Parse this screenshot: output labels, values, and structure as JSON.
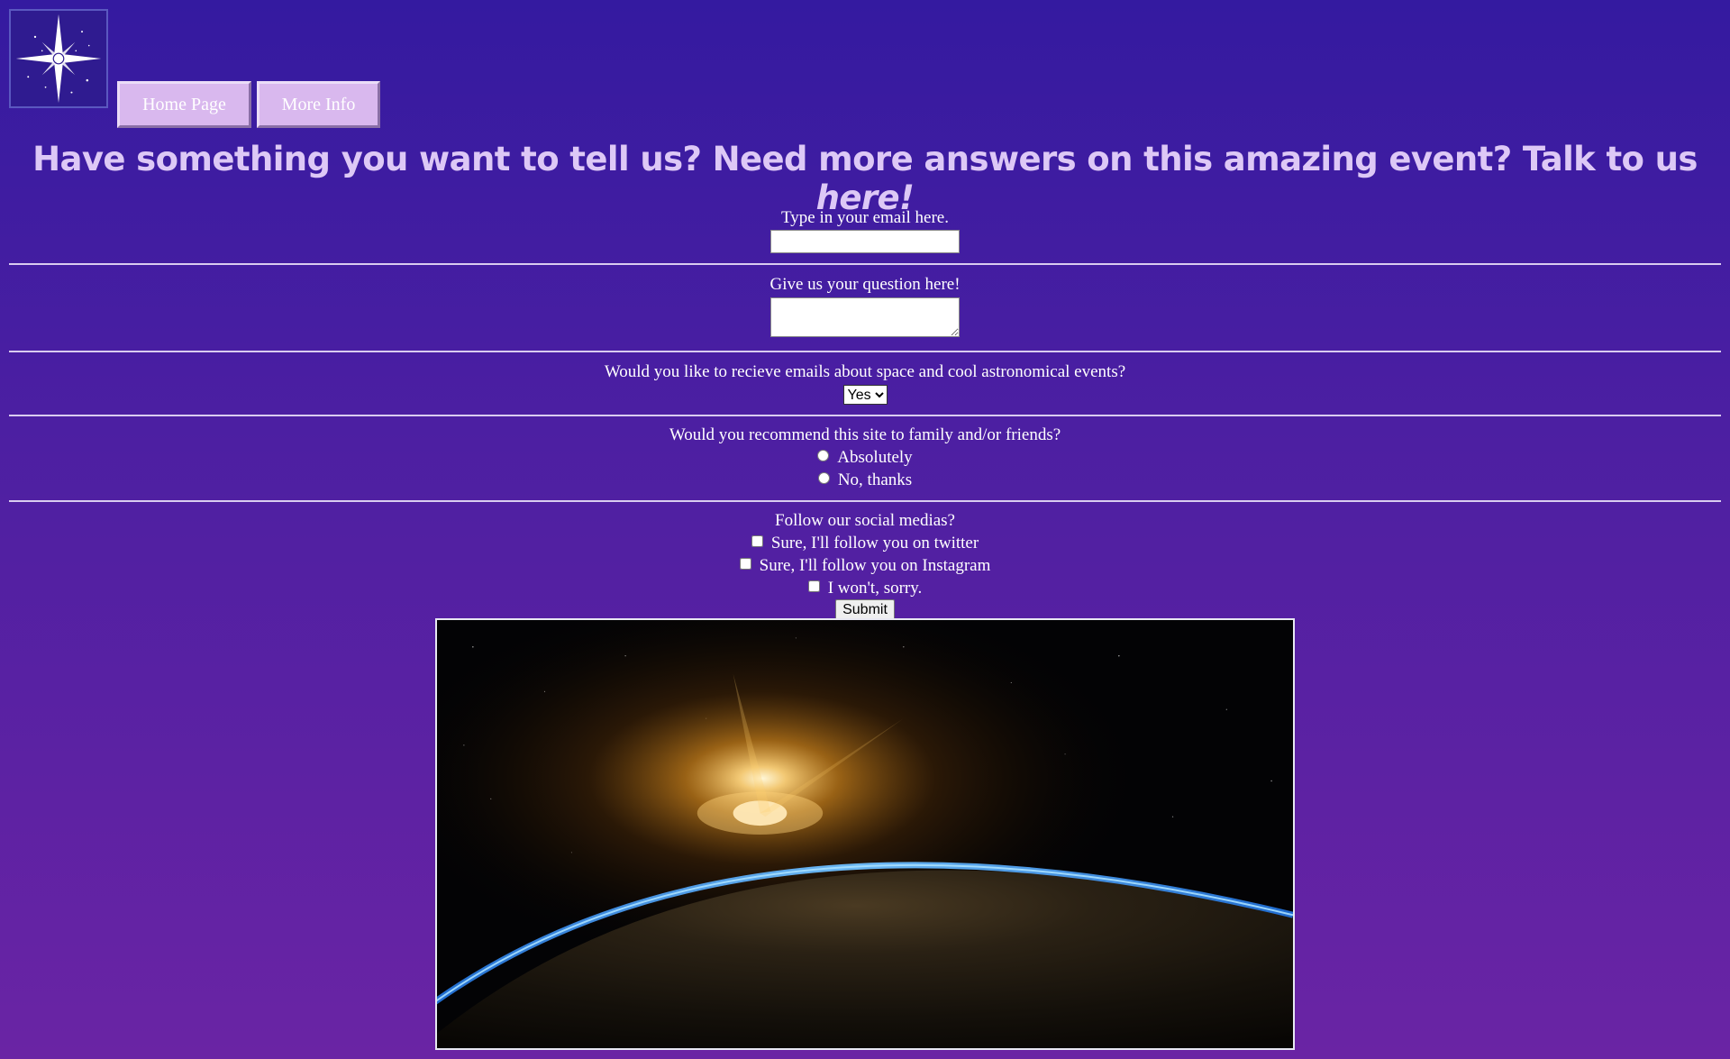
{
  "nav": {
    "logo_name": "star-logo",
    "home_label": "Home Page",
    "info_label": "More Info"
  },
  "headline": {
    "text_main": "Have something you want to tell us? Need more answers on this amazing event? Talk to us ",
    "text_emphasis": "here!"
  },
  "form": {
    "email_label": "Type in your email here.",
    "email_value": "",
    "question_label": "Give us your question here!",
    "question_value": "",
    "newsletter_label": "Would you like to recieve emails about space and cool astronomical events?",
    "newsletter_selected": "Yes",
    "recommend_label": "Would you recommend this site to family and/or friends?",
    "recommend_options": [
      "Absolutely",
      "No, thanks"
    ],
    "social_label": "Follow our social medias?",
    "social_options": [
      "Sure, I'll follow you on twitter",
      "Sure, I'll follow you on Instagram",
      "I won't, sorry."
    ],
    "submit_label": "Submit"
  },
  "image": {
    "subject": "earth-sunrise-from-space"
  },
  "colors": {
    "bg_top": "#341aa0",
    "bg_bottom": "#6a24a4",
    "headline": "#ddc8f6",
    "nav_button": "#d9b8ee"
  }
}
